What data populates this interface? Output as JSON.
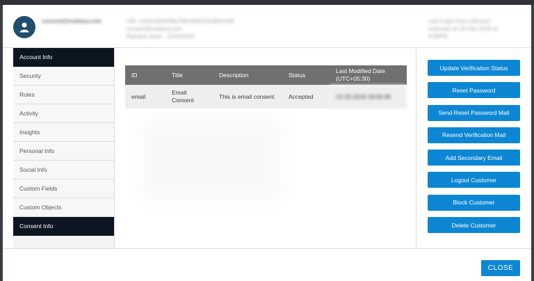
{
  "header": {
    "email": "consent@mailaxy.com",
    "uid_line": "UID: a1b2c3d4e5f6a7b8c9d0e1f2a3b4c5d6",
    "email_line": "consent@mailaxy.com",
    "random_line": "Random since : 12/25/2019",
    "last_login_line1": "Last Login from unknown",
    "last_login_line2": "unknown on 25 Dec 2019 at",
    "last_login_line3": "6:00PM"
  },
  "sidebar": {
    "items": [
      {
        "label": "Account Info",
        "active": true
      },
      {
        "label": "Security",
        "active": false
      },
      {
        "label": "Roles",
        "active": false
      },
      {
        "label": "Activity",
        "active": false
      },
      {
        "label": "Insights",
        "active": false
      },
      {
        "label": "Personal Info",
        "active": false
      },
      {
        "label": "Social Info",
        "active": false
      },
      {
        "label": "Custom Fields",
        "active": false
      },
      {
        "label": "Custom Objects",
        "active": false
      },
      {
        "label": "Consent Info",
        "active": true
      }
    ]
  },
  "table": {
    "headers": [
      "ID",
      "Title",
      "Description",
      "Status",
      "Last Modified Date",
      "(UTC+05:30)"
    ],
    "rows": [
      {
        "id": "email",
        "title_line1": "Email",
        "title_line2": "Consent",
        "description": "This is email consent",
        "status": "Accepted",
        "modified": "12-25-2019 18:00:48"
      }
    ]
  },
  "actions": [
    "Update Verification Status",
    "Reset Password",
    "Send Reset Password Mail",
    "Resend Verification Mail",
    "Add Secondary Email",
    "Logout Customer",
    "Block Customer",
    "Delete Customer"
  ],
  "footer": {
    "close_label": "CLOSE"
  },
  "colors": {
    "accent": "#0d87d4",
    "nav_active": "#0b1620",
    "table_header": "#707070",
    "avatar": "#1f4e6e"
  }
}
